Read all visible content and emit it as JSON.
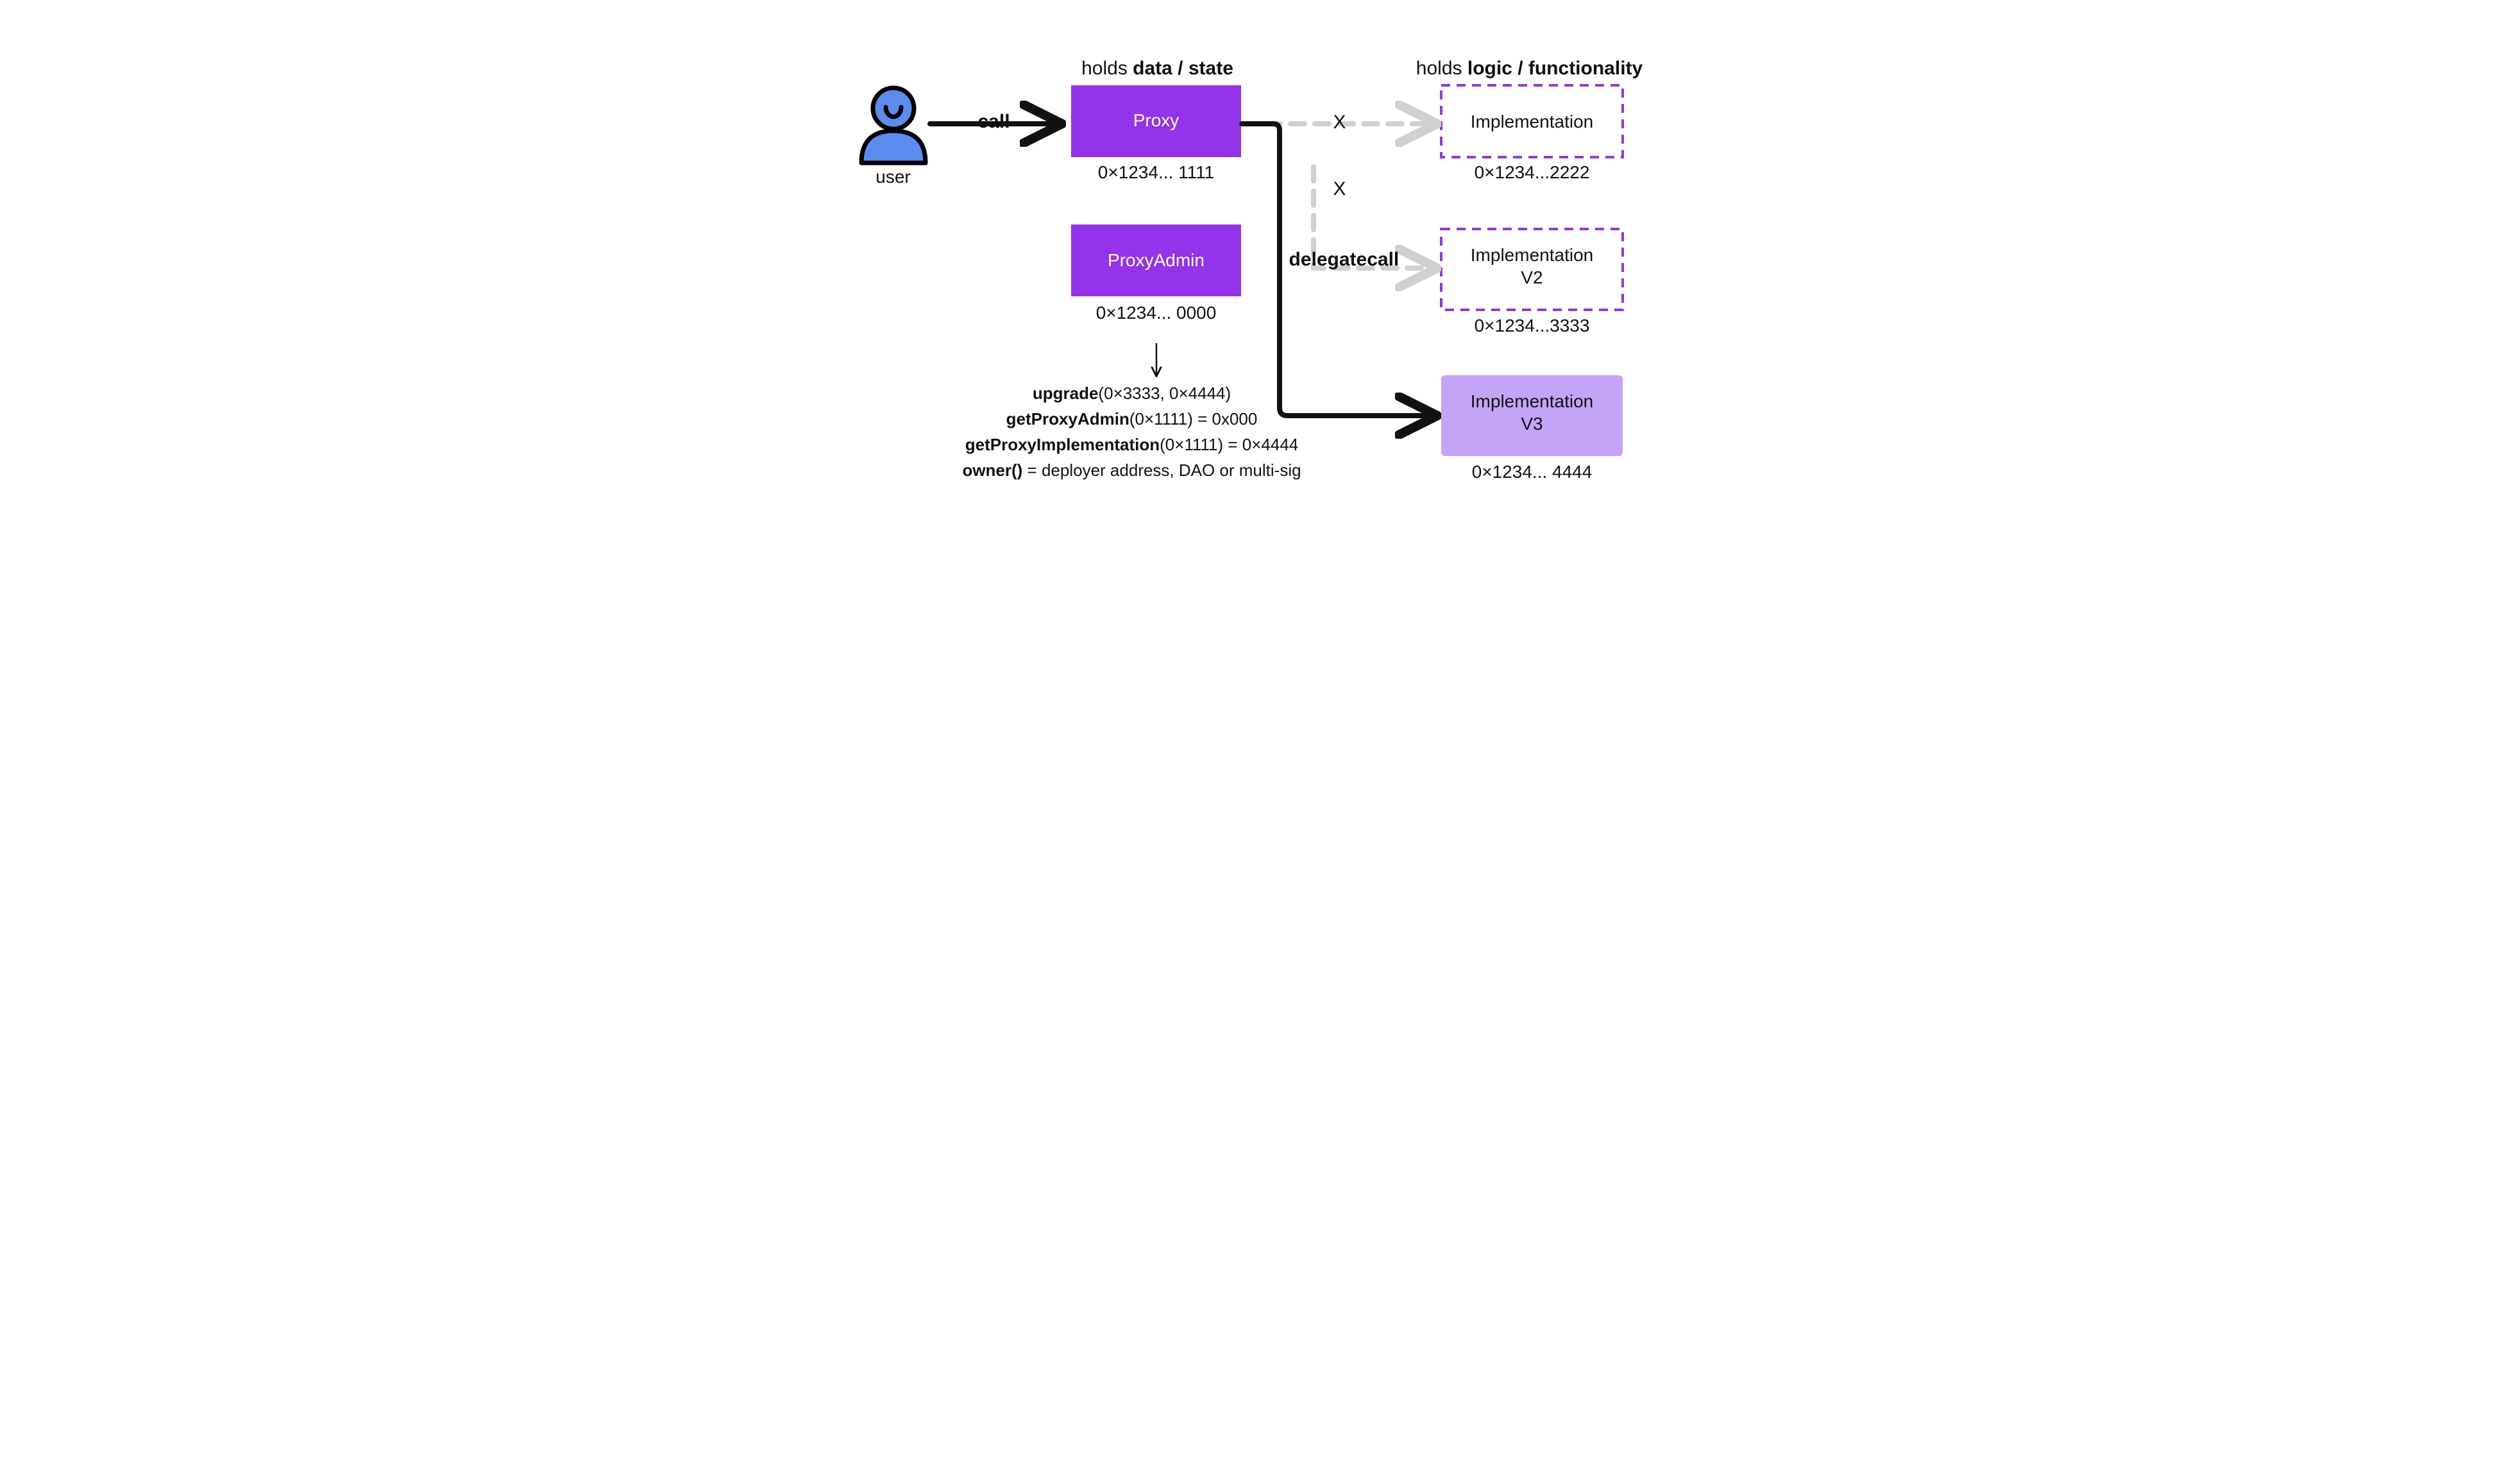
{
  "colors": {
    "purple_solid": "#9333ea",
    "purple_light": "#c4a4f7",
    "purple_stroke": "#9333ea",
    "user_fill": "#5b8def",
    "user_stroke": "#000000",
    "grey_dash": "#d0d0d0",
    "black": "#111111"
  },
  "headers": {
    "data_state_prefix": "holds ",
    "data_state_bold": "data / state",
    "logic_func_prefix": "holds ",
    "logic_func_bold": "logic / functionality"
  },
  "user": {
    "label": "user"
  },
  "arrows": {
    "call": "call",
    "delegatecall": "delegatecall",
    "x1": "X",
    "x2": "X"
  },
  "proxy": {
    "title": "Proxy",
    "addr": "0×1234... 1111"
  },
  "proxy_admin": {
    "title": "ProxyAdmin",
    "addr": "0×1234... 0000"
  },
  "impl1": {
    "title": "Implementation",
    "addr": "0×1234...2222"
  },
  "impl2": {
    "line1": "Implementation",
    "line2": "V2",
    "addr": "0×1234...3333"
  },
  "impl3": {
    "line1": "Implementation",
    "line2": "V3",
    "addr": "0×1234... 4444"
  },
  "fns": {
    "upgrade_b": "upgrade",
    "upgrade_r": "(0×3333, 0×4444)",
    "getadmin_b": "getProxyAdmin",
    "getadmin_r": "(0×1111) = 0x000",
    "getimpl_b": "getProxyImplementation",
    "getimpl_r": "(0×1111) = 0×4444",
    "owner_b": "owner()",
    "owner_r": " = deployer address, DAO or multi-sig"
  }
}
